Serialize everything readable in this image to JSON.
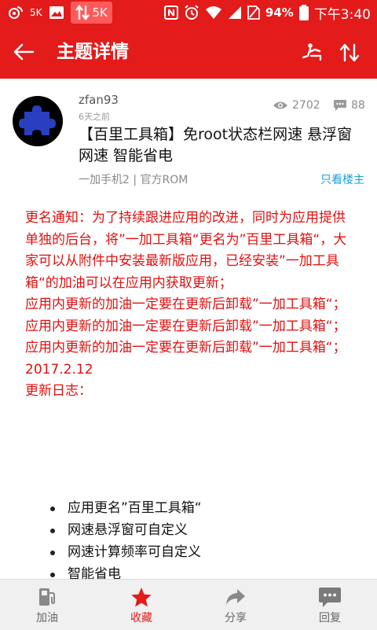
{
  "status_bar": {
    "speed_left": "5K",
    "speed_right": "5K",
    "battery": "94%",
    "time": "下午3:40"
  },
  "app_bar": {
    "title": "主题详情"
  },
  "post": {
    "author": "zfan93",
    "time_ago": "6天之前",
    "views": "2702",
    "replies": "88",
    "title": "【百里工具箱】免root状态栏网速 悬浮窗网速 智能省电",
    "forum": "一加手机2 | 官方ROM",
    "only_op": "只看楼主"
  },
  "body": {
    "notice": "更名通知：为了持续跟进应用的改进，同时为应用提供单独的后台，将”一加工具箱“更名为”百里工具箱“，大家可以从附件中安装最新版应用，已经安装”一加工具箱“的加油可以在应用内获取更新；",
    "repeat_line": "应用内更新的加油一定要在更新后卸载”一加工具箱“；",
    "date": "2017.2.12",
    "changelog_title": "更新日志：",
    "changelog_items": [
      "应用更名”百里工具箱“",
      "网速悬浮窗可自定义",
      "网速计算频率可自定义",
      "智能省电"
    ]
  },
  "bottom_nav": {
    "refuel": "加油",
    "favorite": "收藏",
    "share": "分享",
    "reply": "回复"
  },
  "colors": {
    "accent": "#e31b1b",
    "notice_text": "#e01010",
    "link": "#1e9fd8"
  }
}
